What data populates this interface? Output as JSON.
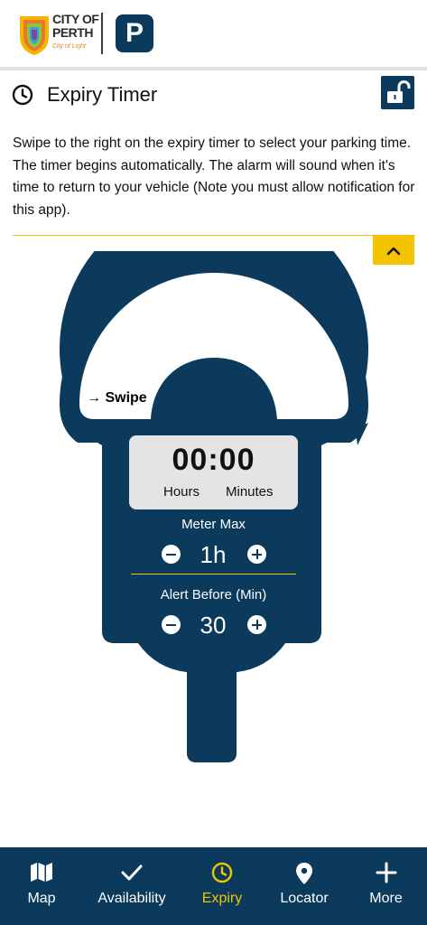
{
  "header": {
    "logo_line1": "CITY OF",
    "logo_line2": "PERTH",
    "logo_tagline": "City of Light",
    "parking_badge": "P"
  },
  "page": {
    "title": "Expiry Timer",
    "title_icon": "clock-icon",
    "lock_icon": "unlocked-padlock-icon",
    "description": "Swipe to the right on the expiry timer to select your parking time. The timer begins automatically. The alarm will sound when it's time to return to your vehicle (Note you must allow notification for this app).",
    "collapse_icon": "chevron-up-icon"
  },
  "meter": {
    "swipe_label": "→ Swipe",
    "timer_value": "00:00",
    "hours_label": "Hours",
    "minutes_label": "Minutes",
    "meter_max_label": "Meter Max",
    "meter_max_value": "1h",
    "alert_before_label": "Alert Before (Min)",
    "alert_before_value": "30"
  },
  "nav": {
    "items": [
      {
        "label": "Map",
        "icon": "map-icon"
      },
      {
        "label": "Availability",
        "icon": "checkmark-icon"
      },
      {
        "label": "Expiry",
        "icon": "clock-icon",
        "active": true
      },
      {
        "label": "Locator",
        "icon": "location-pin-icon"
      },
      {
        "label": "More",
        "icon": "plus-icon"
      }
    ]
  },
  "colors": {
    "brand_navy": "#0b3a5d",
    "accent_yellow": "#f5c400",
    "timer_bg": "#e4e4e4"
  }
}
